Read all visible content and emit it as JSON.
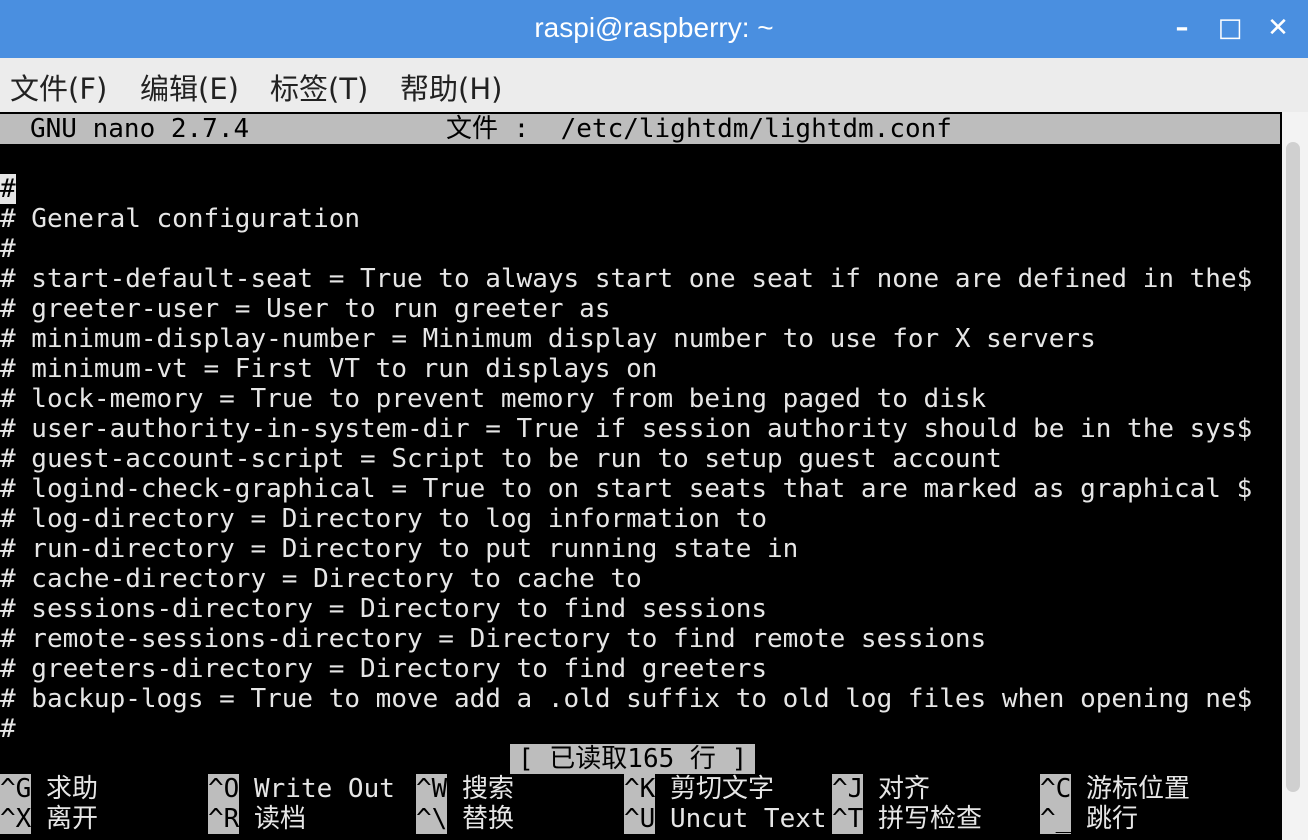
{
  "window": {
    "title": "raspi@raspberry: ~",
    "controls": [
      "minimize-icon",
      "maximize-icon",
      "close-icon"
    ]
  },
  "menu": {
    "file": "文件(F)",
    "edit": "编辑(E)",
    "tabs": "标签(T)",
    "help": "帮助(H)"
  },
  "nano": {
    "version": "GNU nano 2.7.4",
    "file_label": "文件 :  /etc/lightdm/lightdm.conf",
    "lines": [
      "#",
      "# General configuration",
      "#",
      "# start-default-seat = True to always start one seat if none are defined in the$",
      "# greeter-user = User to run greeter as",
      "# minimum-display-number = Minimum display number to use for X servers",
      "# minimum-vt = First VT to run displays on",
      "# lock-memory = True to prevent memory from being paged to disk",
      "# user-authority-in-system-dir = True if session authority should be in the sys$",
      "# guest-account-script = Script to be run to setup guest account",
      "# logind-check-graphical = True to on start seats that are marked as graphical $",
      "# log-directory = Directory to log information to",
      "# run-directory = Directory to put running state in",
      "# cache-directory = Directory to cache to",
      "# sessions-directory = Directory to find sessions",
      "# remote-sessions-directory = Directory to find remote sessions",
      "# greeters-directory = Directory to find greeters",
      "# backup-logs = True to move add a .old suffix to old log files when opening ne$",
      "#"
    ],
    "status": "[ 已读取165 行 ]",
    "shortcuts": [
      {
        "key": "^G",
        "label": "求助"
      },
      {
        "key": "^O",
        "label": "Write Out"
      },
      {
        "key": "^W",
        "label": "搜索"
      },
      {
        "key": "^K",
        "label": "剪切文字"
      },
      {
        "key": "^J",
        "label": "对齐"
      },
      {
        "key": "^C",
        "label": "游标位置"
      },
      {
        "key": "^X",
        "label": "离开"
      },
      {
        "key": "^R",
        "label": "读档"
      },
      {
        "key": "^\\",
        "label": "替换"
      },
      {
        "key": "^U",
        "label": "Uncut Text"
      },
      {
        "key": "^T",
        "label": "拼写检查"
      },
      {
        "key": "^_",
        "label": "跳行"
      }
    ]
  },
  "colors": {
    "titlebar": "#4a8fe0",
    "menubar": "#ececec",
    "terminal_bg": "#000000",
    "terminal_fg": "#e6e6e6",
    "inverse_bar": "#bdbdbd"
  }
}
